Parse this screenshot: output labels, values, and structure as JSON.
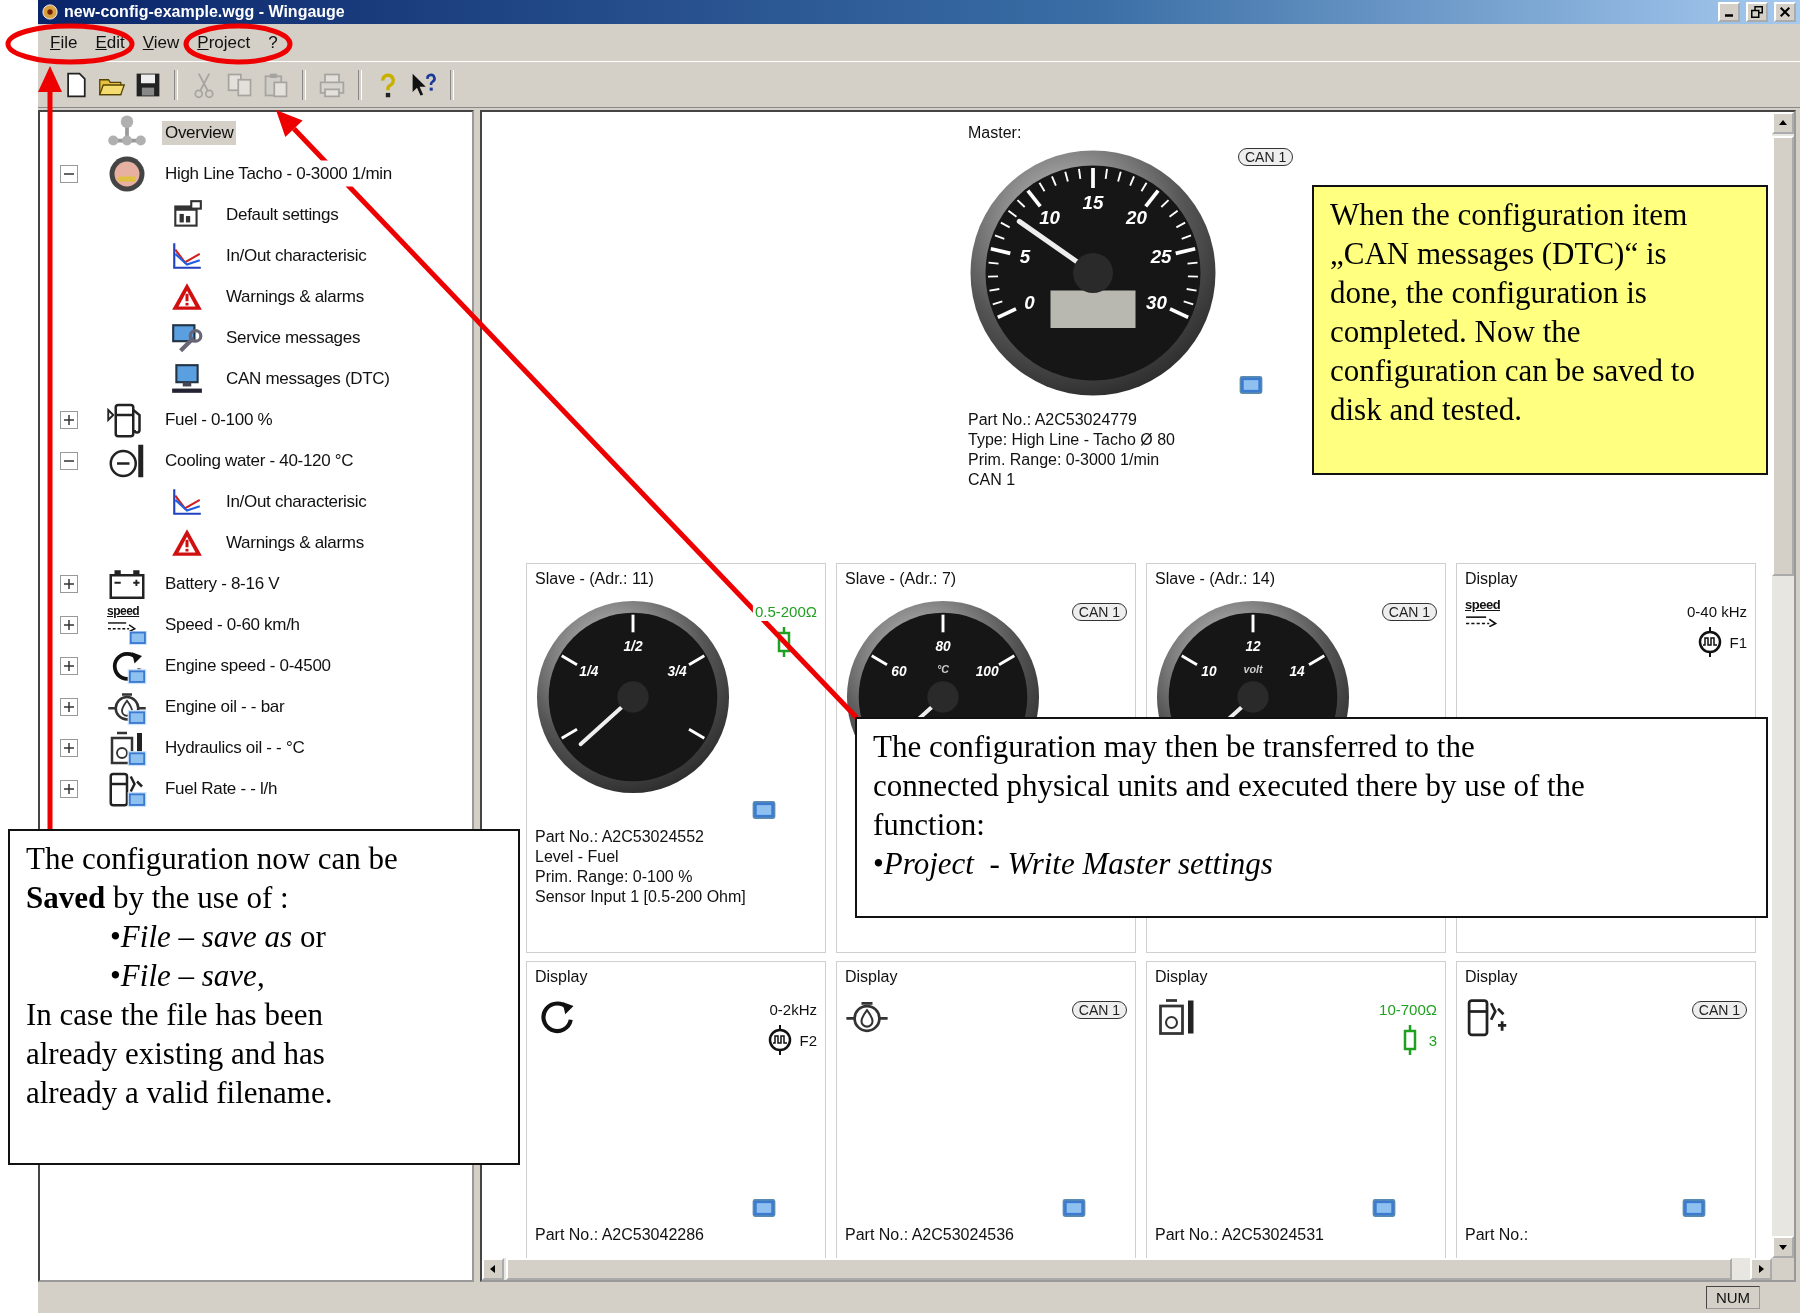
{
  "window": {
    "title": "new-config-example.wgg - Wingauge"
  },
  "menu": [
    "File",
    "Edit",
    "View",
    "Project",
    "?"
  ],
  "toolbar": [
    [
      {
        "kind": "new",
        "disabled": false
      },
      {
        "kind": "open",
        "disabled": false
      },
      {
        "kind": "save",
        "disabled": false
      }
    ],
    [
      {
        "kind": "cut",
        "disabled": true
      },
      {
        "kind": "copy",
        "disabled": true
      },
      {
        "kind": "paste",
        "disabled": true
      }
    ],
    [
      {
        "kind": "print",
        "disabled": true
      }
    ],
    [
      {
        "kind": "help",
        "disabled": false
      },
      {
        "kind": "context_help",
        "disabled": false
      }
    ]
  ],
  "tree": [
    {
      "label": "Overview",
      "kind": "overview",
      "selected": true,
      "linked": false
    },
    {
      "label": "High Line Tacho - 0-3000 1/min",
      "kind": "tacho",
      "selected": false,
      "linked": false,
      "expanded": true,
      "children": [
        {
          "label": "Default settings",
          "kind": "settings",
          "selected": false
        },
        {
          "label": "In/Out characterisic",
          "kind": "chart",
          "selected": false
        },
        {
          "label": "Warnings & alarms",
          "kind": "warning",
          "selected": false
        },
        {
          "label": "Service messages",
          "kind": "service",
          "selected": false
        },
        {
          "label": "CAN messages (DTC)",
          "kind": "can",
          "selected": false
        }
      ]
    },
    {
      "label": "Fuel - 0-100 %",
      "kind": "fuel",
      "selected": false,
      "linked": false,
      "expanded": false
    },
    {
      "label": "Cooling water - 40-120 °C",
      "kind": "coolant",
      "selected": false,
      "linked": false,
      "expanded": true,
      "children": [
        {
          "label": "In/Out characterisic",
          "kind": "chart",
          "selected": false
        },
        {
          "label": "Warnings & alarms",
          "kind": "warning",
          "selected": false
        }
      ]
    },
    {
      "label": "Battery - 8-16 V",
      "kind": "battery",
      "selected": false,
      "linked": false,
      "expanded": false
    },
    {
      "label": "Speed - 0-60 km/h",
      "kind": "speed",
      "icon_label": "speed",
      "selected": false,
      "linked": true,
      "expanded": false
    },
    {
      "label": "Engine speed - 0-4500",
      "kind": "rpm",
      "selected": false,
      "linked": true,
      "expanded": false
    },
    {
      "label": "Engine oil - - bar",
      "kind": "oil",
      "selected": false,
      "linked": true,
      "expanded": false
    },
    {
      "label": "Hydraulics oil - - °C",
      "kind": "hydraulic",
      "selected": false,
      "linked": true,
      "expanded": false
    },
    {
      "label": "Fuel Rate - - l/h",
      "kind": "fuelrate",
      "selected": false,
      "linked": true,
      "expanded": false
    }
  ],
  "master": {
    "label": "Master:",
    "gauge": {
      "dial": [
        "0",
        "5",
        "10",
        "15",
        "20",
        "25",
        "30"
      ]
    },
    "can": "CAN 1",
    "info": [
      "Part No.: A2C53024779",
      "Type: High Line - Tacho Ø 80",
      "Prim. Range: 0-3000 1/min",
      "CAN 1"
    ]
  },
  "cards": [
    {
      "title": "Slave - (Adr.: 11)",
      "kind": "gauge",
      "gauge": {
        "dial": [
          "1/4",
          "1/2",
          "3/4"
        ]
      },
      "range": {
        "text": "0.5-200Ω",
        "color": "#20a020"
      },
      "input": {
        "kind": "resistor"
      },
      "info": [
        "Part No.: A2C53024552",
        "Level - Fuel",
        "Prim. Range: 0-100 %",
        "Sensor Input 1 [0.5-200 Ohm]"
      ]
    },
    {
      "title": "Slave - (Adr.: 7)",
      "kind": "gauge",
      "gauge": {
        "dial": [
          "60",
          "80",
          "100"
        ],
        "unit": "°C"
      },
      "can": "CAN 1"
    },
    {
      "title": "Slave - (Adr.: 14)",
      "kind": "gauge",
      "gauge": {
        "dial": [
          "10",
          "12",
          "14"
        ],
        "unit": "volt"
      },
      "can": "CAN 1"
    },
    {
      "title": "Display",
      "kind": "speed",
      "icon_label": "speed",
      "range": {
        "text": "0-40 kHz",
        "color": "#111111"
      },
      "input": {
        "kind": "freq",
        "label": "F1"
      }
    },
    {
      "title": "Display",
      "kind": "rpm",
      "range": {
        "text": "0-2kHz",
        "color": "#111111"
      },
      "input": {
        "kind": "freq",
        "label": "F2"
      },
      "info": [
        "Part No.: A2C53042286"
      ]
    },
    {
      "title": "Display",
      "kind": "oil",
      "can": "CAN 1",
      "info": [
        "Part No.: A2C53024536"
      ]
    },
    {
      "title": "Display",
      "kind": "hydraulic",
      "range": {
        "text": "10-700Ω",
        "color": "#20a020"
      },
      "input": {
        "kind": "resistor",
        "label": "3"
      },
      "info": [
        "Part No.: A2C53024531"
      ]
    },
    {
      "title": "Display",
      "kind": "fuelrate",
      "can": "CAN 1",
      "info": [
        "Part No.:"
      ]
    }
  ],
  "status_bar": {
    "indicator": "NUM"
  },
  "callouts": [
    {
      "color": "#ffff80",
      "lines": [
        {
          "text": "When the configuration item",
          "indent": false
        },
        {
          "text": "„CAN messages (DTC)“ is",
          "indent": false
        },
        {
          "text": "done, the configuration is",
          "indent": false
        },
        {
          "text": "completed. Now the",
          "indent": false
        },
        {
          "text": "configuration can be saved to",
          "indent": false
        },
        {
          "text": "disk and tested.",
          "indent": false
        }
      ]
    },
    {
      "color": "#ffffff",
      "lines": [
        {
          "text": "The configuration may then be transferred to the",
          "indent": false
        },
        {
          "text": "connected physical units and executed there by use of the",
          "indent": false
        },
        {
          "text": "function:",
          "indent": false
        },
        {
          "text": "•*Project  - Write Master settings*",
          "indent": false
        }
      ]
    },
    {
      "color": "#ffffff",
      "lines": [
        {
          "text": "The configuration now can be",
          "indent": false
        },
        {
          "text": "**Saved** by the use of :",
          "indent": false
        },
        {
          "text": "•*File – save as* or",
          "indent": true
        },
        {
          "text": "•*File – save*,",
          "indent": true
        },
        {
          "text": "In case the file has been",
          "indent": false
        },
        {
          "text": "already existing and has",
          "indent": false
        },
        {
          "text": "already a valid filename.",
          "indent": false
        }
      ]
    }
  ]
}
